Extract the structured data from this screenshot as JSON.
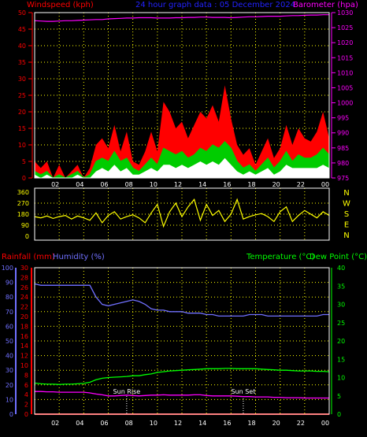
{
  "header": {
    "left_title": "Windspeed (kph)",
    "center_title": "24 hour graph data : 05 December 2024",
    "right_title": "Barometer (hpa)"
  },
  "colors": {
    "background": "#000000",
    "grid": "#ffff00",
    "windspeed": "#ff0000",
    "gust_fill": "#ff0000",
    "wind_avg": "#00cc00",
    "wind_low": "#ffffff",
    "barometer": "#ff00ff",
    "direction": "#ffff00",
    "humidity": "#7070ff",
    "temperature": "#00ff00",
    "dew_point": "#ff00ff",
    "rainfall": "#ff0000",
    "frame": "#ffffff",
    "sun_marker": "#ffffff",
    "left_axis_red": "#ff0000",
    "center_title_blue": "#2222ff",
    "humidity_axis": "#7070ff"
  },
  "time_axis": {
    "tick_labels": [
      "02",
      "04",
      "06",
      "08",
      "10",
      "12",
      "14",
      "16",
      "18",
      "20",
      "22",
      "00"
    ],
    "hours_span": 24
  },
  "chart_data": [
    {
      "id": "wind",
      "type": "area",
      "left_axis": {
        "label": "Windspeed (kph)",
        "ticks": [
          "0",
          "5",
          "10",
          "15",
          "20",
          "25",
          "30",
          "35",
          "40",
          "45",
          "50"
        ],
        "ylim": [
          0,
          50
        ]
      },
      "right_axis": {
        "label": "Barometer (hpa)",
        "ticks": [
          "975",
          "980",
          "985",
          "990",
          "995",
          "1000",
          "1005",
          "1010",
          "1015",
          "1020",
          "1025",
          "1030"
        ],
        "ylim": [
          975,
          1030
        ]
      },
      "x_hours": [
        0,
        0.5,
        1,
        1.5,
        2,
        2.5,
        3,
        3.5,
        4,
        4.5,
        5,
        5.5,
        6,
        6.5,
        7,
        7.5,
        8,
        8.5,
        9,
        9.5,
        10,
        10.5,
        11,
        11.5,
        12,
        12.5,
        13,
        13.5,
        14,
        14.5,
        15,
        15.5,
        16,
        16.5,
        17,
        17.5,
        18,
        18.5,
        19,
        19.5,
        20,
        20.5,
        21,
        21.5,
        22,
        22.5,
        23,
        23.5,
        24
      ],
      "series": [
        {
          "kind": "gust",
          "values": [
            5,
            3,
            5,
            0,
            4,
            0,
            2,
            4,
            0,
            3,
            10,
            12,
            9,
            16,
            8,
            14,
            5,
            4,
            8,
            14,
            8,
            23,
            20,
            15,
            17,
            12,
            16,
            20,
            18,
            22,
            17,
            28,
            18,
            10,
            7,
            9,
            4,
            8,
            12,
            6,
            9,
            16,
            10,
            15,
            12,
            11,
            14,
            20,
            12
          ]
        },
        {
          "kind": "average",
          "values": [
            2,
            1,
            2,
            0,
            1,
            0,
            1,
            2,
            0,
            1,
            5,
            6,
            5,
            8,
            5,
            6,
            3,
            2,
            4,
            6,
            4,
            9,
            8,
            7,
            8,
            6,
            7,
            9,
            8,
            10,
            9,
            11,
            9,
            5,
            3,
            4,
            2,
            4,
            6,
            3,
            5,
            8,
            5,
            7,
            6,
            6,
            7,
            9,
            7
          ]
        },
        {
          "kind": "low",
          "values": [
            1,
            0,
            1,
            0,
            0,
            0,
            0,
            1,
            0,
            0,
            2,
            3,
            2,
            4,
            2,
            3,
            1,
            1,
            2,
            3,
            2,
            4,
            4,
            3,
            4,
            3,
            4,
            5,
            4,
            5,
            4,
            6,
            4,
            2,
            1,
            2,
            1,
            2,
            3,
            1,
            2,
            4,
            3,
            3,
            3,
            3,
            3,
            4,
            3
          ]
        },
        {
          "kind": "barometer",
          "values": [
            1027.3,
            1027.2,
            1027.1,
            1027.1,
            1027.2,
            1027.3,
            1027.3,
            1027.4,
            1027.5,
            1027.6,
            1027.7,
            1027.7,
            1027.9,
            1028.0,
            1028.1,
            1028.2,
            1028.2,
            1028.3,
            1028.3,
            1028.3,
            1028.2,
            1028.2,
            1028.2,
            1028.3,
            1028.3,
            1028.4,
            1028.4,
            1028.5,
            1028.5,
            1028.4,
            1028.4,
            1028.4,
            1028.3,
            1028.4,
            1028.5,
            1028.6,
            1028.6,
            1028.7,
            1028.8,
            1028.8,
            1028.8,
            1028.9,
            1029.0,
            1029.0,
            1029.1,
            1029.2,
            1029.2,
            1029.3,
            1029.3
          ]
        }
      ]
    },
    {
      "id": "direction",
      "type": "line",
      "left_axis": {
        "ticks": [
          "0",
          "90",
          "180",
          "270",
          "360"
        ],
        "ylim": [
          0,
          360
        ]
      },
      "right_axis": {
        "ticks": [
          "N",
          "W",
          "S",
          "E",
          "N"
        ]
      },
      "x_hours": [
        0,
        0.5,
        1,
        1.5,
        2,
        2.5,
        3,
        3.5,
        4,
        4.5,
        5,
        5.5,
        6,
        6.5,
        7,
        7.5,
        8,
        8.5,
        9,
        9.5,
        10,
        10.5,
        11,
        11.5,
        12,
        12.5,
        13,
        13.5,
        14,
        14.5,
        15,
        15.5,
        16,
        16.5,
        17,
        17.5,
        18,
        18.5,
        19,
        19.5,
        20,
        20.5,
        21,
        21.5,
        22,
        22.5,
        23,
        23.5,
        24
      ],
      "values": [
        160,
        150,
        165,
        145,
        160,
        170,
        140,
        165,
        150,
        130,
        190,
        110,
        170,
        200,
        140,
        160,
        175,
        150,
        110,
        190,
        260,
        80,
        200,
        270,
        160,
        240,
        300,
        130,
        260,
        170,
        210,
        120,
        180,
        300,
        140,
        160,
        175,
        185,
        160,
        120,
        200,
        240,
        120,
        170,
        210,
        180,
        150,
        200,
        170
      ]
    },
    {
      "id": "climate",
      "type": "line",
      "left_axis": {
        "label": "Rainfall (mm)",
        "ticks": [
          "0",
          "2",
          "4",
          "6",
          "8",
          "10",
          "12",
          "14",
          "16",
          "18",
          "20",
          "22",
          "24",
          "26",
          "28",
          "30"
        ],
        "ylim": [
          0,
          30
        ]
      },
      "humidity_axis": {
        "label": "Humidity (%)",
        "ticks": [
          "0",
          "10",
          "20",
          "30",
          "40",
          "50",
          "60",
          "70",
          "80",
          "90",
          "100"
        ],
        "ylim": [
          0,
          100
        ]
      },
      "right_axis": {
        "label": "Temperature (°C)",
        "ticks": [
          "0",
          "5",
          "10",
          "15",
          "20",
          "25",
          "30",
          "35",
          "40"
        ],
        "ylim": [
          0,
          40
        ]
      },
      "right_label_2": "Dew Point (°C)",
      "x_hours": [
        0,
        0.5,
        1,
        1.5,
        2,
        2.5,
        3,
        3.5,
        4,
        4.5,
        5,
        5.5,
        6,
        6.5,
        7,
        7.5,
        8,
        8.5,
        9,
        9.5,
        10,
        10.5,
        11,
        11.5,
        12,
        12.5,
        13,
        13.5,
        14,
        14.5,
        15,
        15.5,
        16,
        16.5,
        17,
        17.5,
        18,
        18.5,
        19,
        19.5,
        20,
        20.5,
        21,
        21.5,
        22,
        22.5,
        23,
        23.5,
        24
      ],
      "series": [
        {
          "name": "Humidity (%)",
          "axis": "humidity",
          "values": [
            89,
            88,
            88,
            88,
            88,
            88,
            88,
            88,
            88,
            88,
            80,
            75,
            74,
            75,
            76,
            77,
            78,
            77,
            75,
            72,
            71,
            71,
            70,
            70,
            70,
            69,
            69,
            69,
            68,
            68,
            67,
            67,
            67,
            67,
            67,
            68,
            68,
            68,
            67,
            67,
            67,
            67,
            67,
            67,
            67,
            67,
            67,
            68,
            68
          ]
        },
        {
          "name": "Temperature (°C)",
          "axis": "temperature",
          "values": [
            8.5,
            8.3,
            8.2,
            8.2,
            8.1,
            8.2,
            8.2,
            8.3,
            8.4,
            8.7,
            9.4,
            9.8,
            10.0,
            10.1,
            10.2,
            10.3,
            10.5,
            10.5,
            10.8,
            11.0,
            11.4,
            11.6,
            11.8,
            11.9,
            12.0,
            12.1,
            12.2,
            12.3,
            12.4,
            12.4,
            12.4,
            12.5,
            12.5,
            12.4,
            12.4,
            12.4,
            12.4,
            12.3,
            12.2,
            12.1,
            12.0,
            12.0,
            11.9,
            11.8,
            11.8,
            11.8,
            11.7,
            11.7,
            11.6
          ]
        },
        {
          "name": "Dew Point (°C)",
          "axis": "temperature",
          "values": [
            6.2,
            6.2,
            6.1,
            6.1,
            6.0,
            6.0,
            6.0,
            6.0,
            6.0,
            5.8,
            5.5,
            5.3,
            5.0,
            5.0,
            5.1,
            5.2,
            5.1,
            5.0,
            5.1,
            5.2,
            5.2,
            5.3,
            5.2,
            5.2,
            5.2,
            5.2,
            5.3,
            5.3,
            5.1,
            5.0,
            5.0,
            5.0,
            5.0,
            4.9,
            4.8,
            4.8,
            4.7,
            4.7,
            4.7,
            4.6,
            4.6,
            4.5,
            4.5,
            4.5,
            4.4,
            4.4,
            4.4,
            4.4,
            4.4
          ]
        },
        {
          "name": "Rainfall (mm)",
          "axis": "rainfall",
          "values": [
            0,
            0,
            0,
            0,
            0,
            0,
            0,
            0,
            0,
            0,
            0,
            0,
            0,
            0,
            0,
            0,
            0,
            0,
            0,
            0,
            0,
            0,
            0,
            0,
            0,
            0,
            0,
            0,
            0,
            0,
            0,
            0,
            0,
            0,
            0,
            0,
            0,
            0,
            0,
            0,
            0,
            0,
            0,
            0,
            0,
            0,
            0,
            0,
            0
          ]
        }
      ],
      "markers": [
        {
          "label": "Sun Rise",
          "hour": 7.5
        },
        {
          "label": "Sun Set",
          "hour": 17.0
        }
      ]
    }
  ]
}
